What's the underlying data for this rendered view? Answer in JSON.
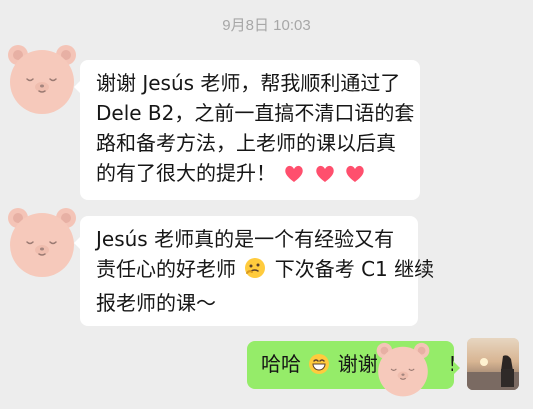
{
  "timestamp": "9月8日 10:03",
  "messages": [
    {
      "side": "left",
      "lines": [
        "谢谢 Jesús 老师，帮我顺利通过了",
        "Dele B2，之前一直搞不清口语的套",
        "路和备考方法，上老师的课以后真",
        "的有了很大的提升！"
      ],
      "trailing_emoji": "heart-emoji x3"
    },
    {
      "side": "left",
      "lines": [
        "Jesús 老师真的是一个有经验又有",
        "责任心的好老师",
        "下次备考 C1 继续",
        "报老师的课～"
      ],
      "inline_emoji": "thinking-face-emoji"
    },
    {
      "side": "right",
      "text_before_emoji": "哈哈",
      "inline_emoji": "grinning-face-emoji",
      "text_after_emoji": "谢谢",
      "end_text": "!"
    }
  ],
  "colors": {
    "background": "#ededed",
    "incoming_bubble": "#ffffff",
    "outgoing_bubble": "#95ec69",
    "avatar_bear": "#f6c9bb"
  }
}
